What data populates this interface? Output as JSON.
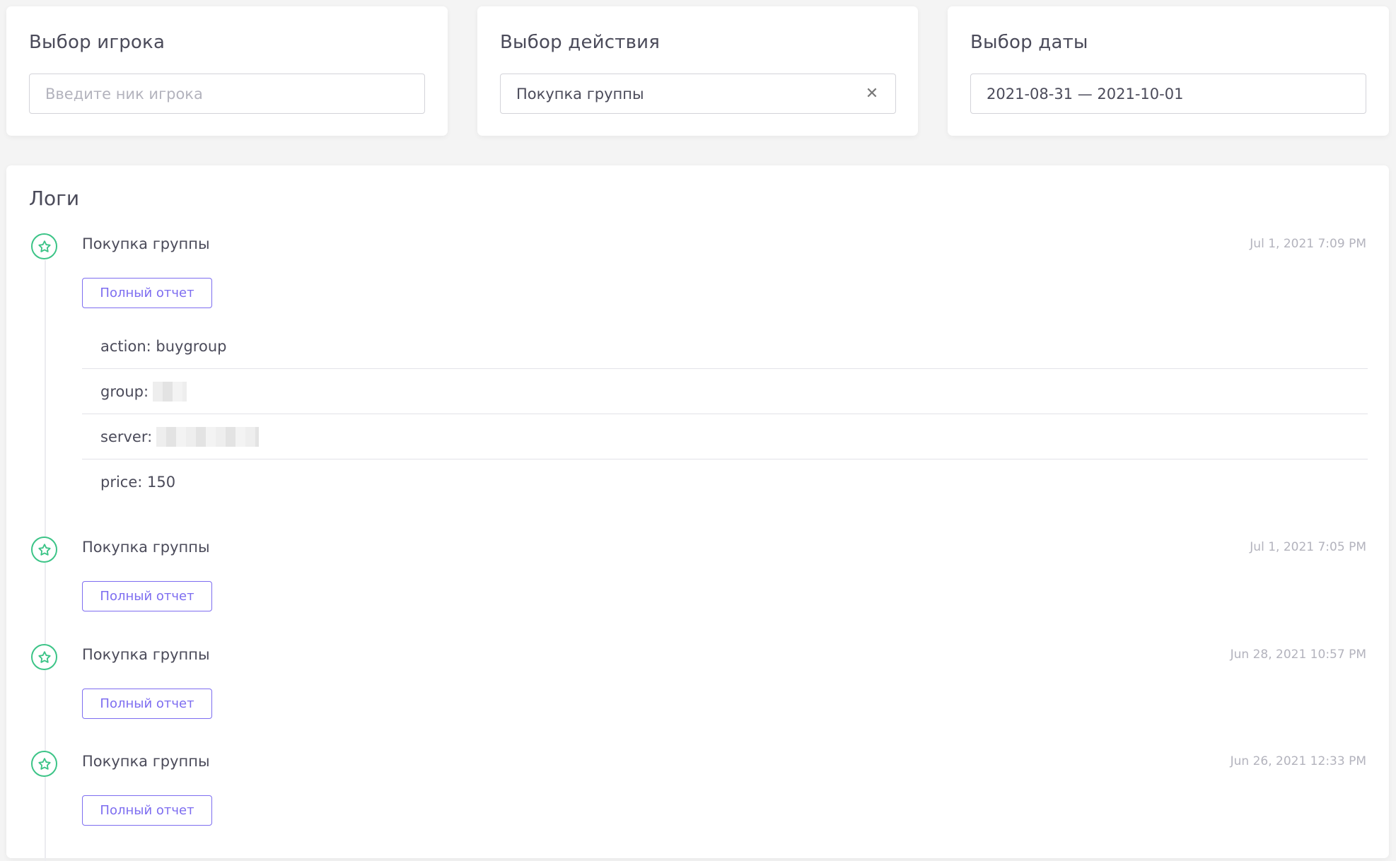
{
  "filters": {
    "player": {
      "title": "Выбор игрока",
      "placeholder": "Введите ник игрока",
      "value": ""
    },
    "action": {
      "title": "Выбор действия",
      "value": "Покупка группы",
      "clear_icon": "close-icon"
    },
    "date": {
      "title": "Выбор даты",
      "value": "2021-08-31 — 2021-10-01"
    }
  },
  "logs": {
    "title": "Логи",
    "marker_icon": "star-icon",
    "marker_color": "#3cc487",
    "accent_color": "#7d6df0",
    "report_label": "Полный отчет",
    "entries": [
      {
        "title": "Покупка группы",
        "time": "Jul 1, 2021 7:09 PM",
        "details": {
          "action_label": "action:",
          "action_value": "buygroup",
          "group_label": "group:",
          "server_label": "server:",
          "price_label": "price:",
          "price_value": "150"
        }
      },
      {
        "title": "Покупка группы",
        "time": "Jul 1, 2021 7:05 PM"
      },
      {
        "title": "Покупка группы",
        "time": "Jun 28, 2021 10:57 PM"
      },
      {
        "title": "Покупка группы",
        "time": "Jun 26, 2021 12:33 PM"
      }
    ]
  }
}
